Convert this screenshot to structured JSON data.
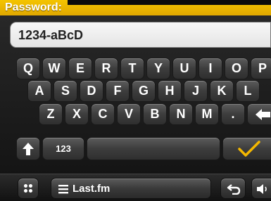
{
  "title": "Password:",
  "password_value": "1234-aBcD",
  "keyboard": {
    "row1": [
      "Q",
      "W",
      "E",
      "R",
      "T",
      "Y",
      "U",
      "I",
      "O",
      "P"
    ],
    "row2": [
      "A",
      "S",
      "D",
      "F",
      "G",
      "H",
      "J",
      "K",
      "L"
    ],
    "row3": [
      "Z",
      "X",
      "C",
      "V",
      "B",
      "N",
      "M",
      "."
    ],
    "numbers_key": "123"
  },
  "footer": {
    "source_label": "Last.fm"
  },
  "colors": {
    "accent": "#f0b800",
    "check": "#f5b800"
  },
  "icons": [
    "shift-icon",
    "backspace-icon",
    "checkmark-icon",
    "apps-grid-icon",
    "menu-icon",
    "back-icon",
    "volume-icon"
  ]
}
